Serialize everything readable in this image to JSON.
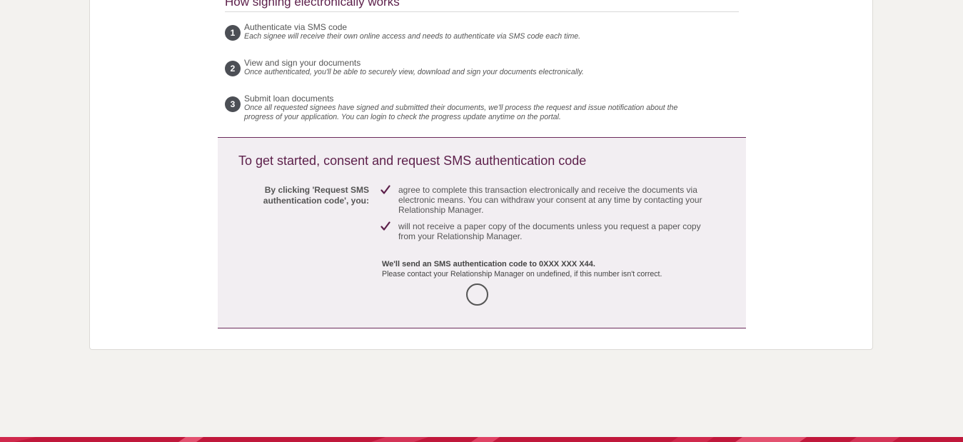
{
  "section": {
    "title": "How signing electronically works"
  },
  "steps": [
    {
      "number": "1",
      "title": "Authenticate via SMS code",
      "description": "Each signee will receive their own online access and needs to authenticate via SMS code each time."
    },
    {
      "number": "2",
      "title": "View and sign your documents",
      "description": "Once authenticated, you'll be able to securely view, download and sign your documents electronically."
    },
    {
      "number": "3",
      "title": "Submit loan documents",
      "description": "Once all requested signees have signed and submitted their documents, we'll process the request and issue notification about the progress of your application. You can login to check the progress update anytime on the portal."
    }
  ],
  "consent": {
    "title": "To get started, consent and request SMS authentication code",
    "lead": "By clicking 'Request SMS authentication code', you:",
    "items": [
      "agree to complete this transaction electronically and receive the documents via electronic means. You can withdraw your consent at any time by contacting your Relationship Manager.",
      "will not receive a paper copy of the documents unless you request a paper copy from your Relationship Manager."
    ],
    "sms_notice": "We'll send an SMS authentication code to 0XXX XXX X44.",
    "sms_note": "Please contact your Relationship Manager on undefined, if this number isn't correct.",
    "loading_icon": "loading-spinner-icon"
  },
  "colors": {
    "accent": "#5c1f4a",
    "footer": "#c0183b",
    "badge": "#4c4f55",
    "consent_bg": "#f2eef2"
  }
}
